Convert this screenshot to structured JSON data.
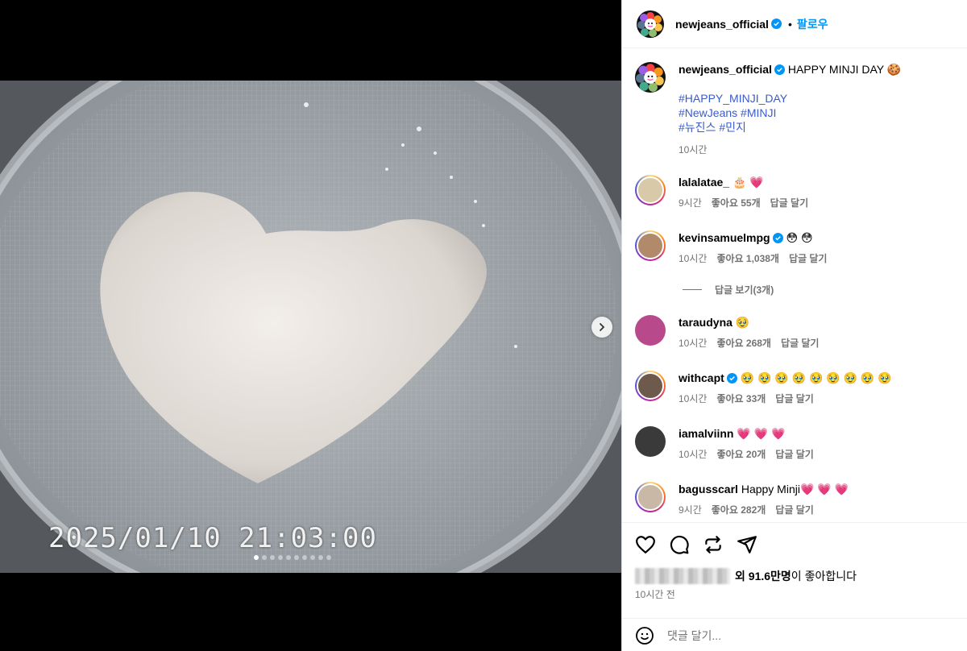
{
  "photo": {
    "timestamp": "2025/01/10 21:03:00",
    "dots_total": 10,
    "dots_active": 1
  },
  "header": {
    "username": "newjeans_official",
    "separator": "•",
    "follow_label": "팔로우"
  },
  "caption": {
    "username": "newjeans_official",
    "text": "HAPPY MINJI DAY",
    "emoji": "🍪",
    "hashtags": [
      "#HAPPY_MINJI_DAY",
      "#NewJeans #MINJI",
      "#뉴진스 #민지"
    ],
    "time": "10시간"
  },
  "comments": [
    {
      "username": "lalalatae_",
      "verified": false,
      "text": "",
      "emoji": "🎂 💗",
      "time": "9시간",
      "likes": "좋아요 55개",
      "reply": "답글 달기",
      "avatar_color": "#d8c9a8"
    },
    {
      "username": "kevinsamuelmpg",
      "verified": true,
      "text": "",
      "emoji": "😳 😳",
      "time": "10시간",
      "likes": "좋아요 1,038개",
      "reply": "답글 달기",
      "avatar_color": "#b08a6a"
    },
    {
      "username": "taraudyna",
      "verified": false,
      "text": "",
      "emoji": "🥹",
      "time": "10시간",
      "likes": "좋아요 268개",
      "reply": "답글 달기",
      "avatar_color": "#b84a8c"
    },
    {
      "username": "withcapt",
      "verified": true,
      "text": "",
      "emoji": "🥹 🥹 🥹 🥹 🥹 🥹 🥹 🥹 🥹",
      "time": "10시간",
      "likes": "좋아요 33개",
      "reply": "답글 달기",
      "avatar_color": "#6d5a4c"
    },
    {
      "username": "iamalviinn",
      "verified": false,
      "text": "",
      "emoji": "💗 💗 💗",
      "time": "10시간",
      "likes": "좋아요 20개",
      "reply": "답글 달기",
      "avatar_color": "#3a3a3a"
    },
    {
      "username": "bagusscarl",
      "verified": false,
      "text": "Happy Minji",
      "emoji": "💗 💗 💗",
      "time": "9시간",
      "likes": "좋아요 282개",
      "reply": "답글 달기",
      "avatar_color": "#c9b8a6"
    }
  ],
  "replies_toggle": "답글 보기(3개)",
  "likes": {
    "prefix": "외",
    "count": "91.6만명",
    "suffix": "이 좋아합니다"
  },
  "posted_ago": "10시간 전",
  "add_comment_placeholder": "댓글 달기...",
  "colors": {
    "link_blue": "#0095f6",
    "hashtag": "#3b5bc9",
    "muted": "#737373"
  },
  "icons": [
    "heart-icon",
    "comment-icon",
    "repost-icon",
    "share-icon",
    "emoji-icon",
    "chevron-right-icon",
    "verified-icon"
  ]
}
